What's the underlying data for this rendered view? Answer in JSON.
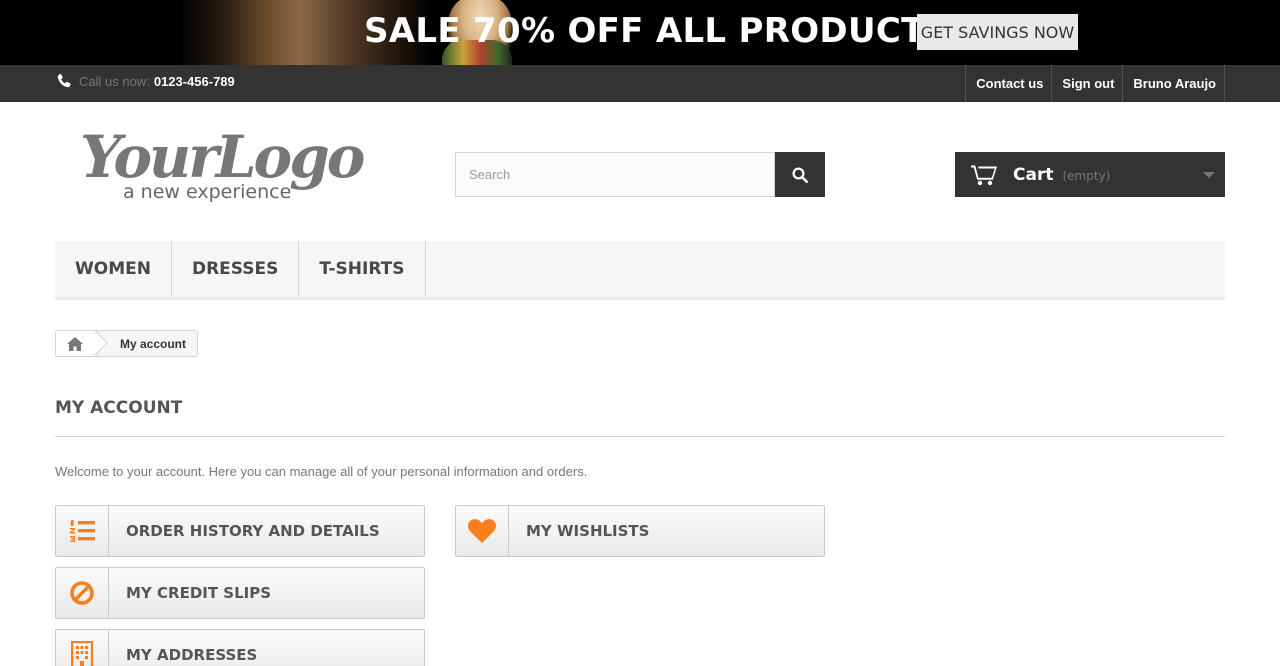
{
  "promo": {
    "headline": "SALE 70% OFF ALL PRODUCTS",
    "cta_label": "GET SAVINGS NOW"
  },
  "topbar": {
    "phone_prefix": "Call us now:",
    "phone_number": "0123-456-789",
    "links": [
      "Contact us",
      "Sign out",
      "Bruno Araujo"
    ]
  },
  "logo": {
    "script_text": "YourLogo",
    "tagline": "a new experience"
  },
  "search": {
    "placeholder": "Search",
    "value": ""
  },
  "cart": {
    "label": "Cart",
    "status": "(empty)"
  },
  "menu": {
    "items": [
      "WOMEN",
      "DRESSES",
      "T-SHIRTS"
    ]
  },
  "breadcrumb": {
    "current": "My account"
  },
  "page": {
    "heading": "MY ACCOUNT",
    "welcome": "Welcome to your account. Here you can manage all of your personal information and orders."
  },
  "account_buttons": [
    {
      "label": "ORDER HISTORY AND DETAILS",
      "icon": "list-ol-icon"
    },
    {
      "label": "MY WISHLISTS",
      "icon": "heart-icon"
    },
    {
      "label": "MY CREDIT SLIPS",
      "icon": "ban-icon"
    },
    {
      "label": "MY ADDRESSES",
      "icon": "building-icon"
    }
  ],
  "colors": {
    "accent_orange": "#F97F1E",
    "dark_bar": "#333333",
    "menu_bg": "#F6F6F6"
  }
}
